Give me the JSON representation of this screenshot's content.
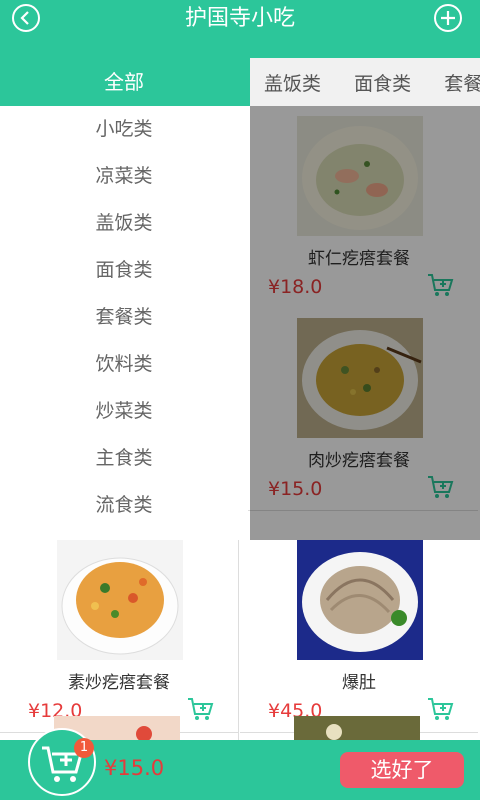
{
  "header": {
    "title": "护国寺小吃"
  },
  "all_tab": "全部",
  "category_tabs": [
    "盖饭类",
    "面食类",
    "套餐类"
  ],
  "sidebar": [
    "小吃类",
    "凉菜类",
    "盖饭类",
    "面食类",
    "套餐类",
    "饮料类",
    "炒菜类",
    "主食类",
    "流食类"
  ],
  "items": [
    {
      "name": "",
      "price": ""
    },
    {
      "name": "虾仁疙瘩套餐",
      "price": "¥18.0"
    },
    {
      "name": "",
      "price": ""
    },
    {
      "name": "肉炒疙瘩套餐",
      "price": "¥15.0"
    },
    {
      "name": "素炒疙瘩套餐",
      "price": "¥12.0"
    },
    {
      "name": "爆肚",
      "price": "¥45.0"
    }
  ],
  "cart": {
    "count": "1",
    "total": "¥15.0",
    "submit_label": "选好了"
  },
  "colors": {
    "accent": "#2cc69a",
    "price": "#e63b3b",
    "submit": "#ef5a6a"
  }
}
